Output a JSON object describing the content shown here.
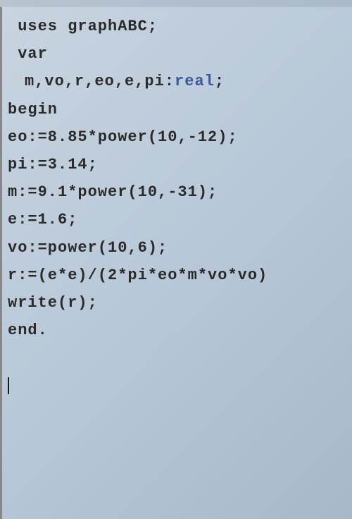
{
  "code": {
    "line1_uses": "uses",
    "line1_module": " graphABC;",
    "line2_var": "var",
    "line3_decl": "m,vo,r,eo,e,pi:",
    "line3_type": "real",
    "line3_end": ";",
    "line4_begin": "begin",
    "line5": "eo:=8.85*power(10,-12);",
    "line6": "pi:=3.14;",
    "line7": "m:=9.1*power(10,-31);",
    "line8": "e:=1.6;",
    "line9": "vo:=power(10,6);",
    "line10": "r:=(e*e)/(2*pi*eo*m*vo*vo)",
    "line11": "write(r);",
    "line12": "end."
  }
}
